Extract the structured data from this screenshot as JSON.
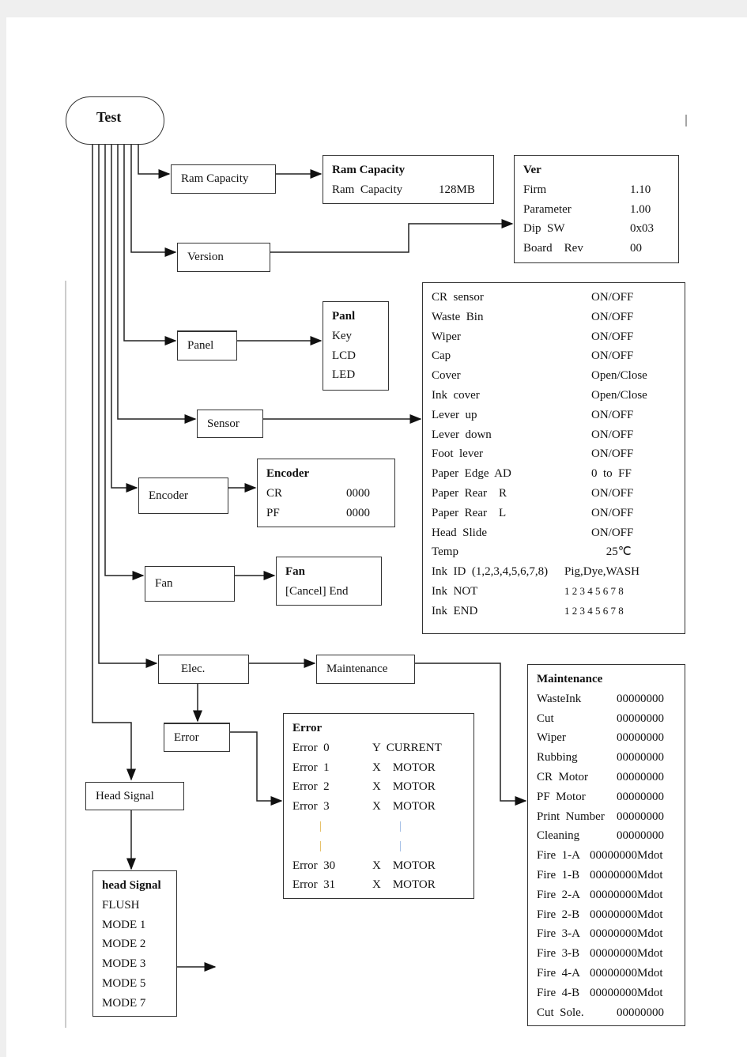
{
  "root": {
    "label": "Test"
  },
  "ram": {
    "button": "Ram  Capacity",
    "title": "Ram  Capacity",
    "rows": [
      [
        "Ram  Capacity",
        "128MB"
      ]
    ]
  },
  "version": {
    "button": "Version",
    "title": "Ver",
    "rows": [
      [
        "Firm",
        "1.10"
      ],
      [
        "Parameter",
        "1.00"
      ],
      [
        "Dip  SW",
        "0x03"
      ],
      [
        "Board    Rev",
        "00"
      ]
    ]
  },
  "panel": {
    "button": "Panel",
    "title": "Panl",
    "items": [
      "Key",
      "LCD",
      "LED"
    ]
  },
  "sensor": {
    "button": "Sensor",
    "rows": [
      [
        "CR  sensor",
        "ON/OFF"
      ],
      [
        "Waste  Bin",
        "ON/OFF"
      ],
      [
        "Wiper",
        "ON/OFF"
      ],
      [
        "Cap",
        "ON/OFF"
      ],
      [
        "Cover",
        "Open/Close"
      ],
      [
        "Ink  cover",
        "Open/Close"
      ],
      [
        "Lever  up",
        "ON/OFF"
      ],
      [
        "Lever  down",
        "ON/OFF"
      ],
      [
        "Foot  lever",
        "ON/OFF"
      ],
      [
        "Paper  Edge  AD",
        "0  to  FF"
      ],
      [
        "Paper  Rear    R",
        "ON/OFF"
      ],
      [
        "Paper  Rear    L",
        "ON/OFF"
      ],
      [
        "Head  Slide",
        "ON/OFF"
      ],
      [
        "Temp",
        "     25℃"
      ],
      [
        "Ink  ID  (1,2,3,4,5,6,7,8)",
        "Pig,Dye,WASH"
      ],
      [
        "Ink  NOT",
        "1 2 3 4 5 6 7 8"
      ],
      [
        "Ink  END",
        "1 2 3 4 5 6 7 8"
      ]
    ]
  },
  "encoder": {
    "button": "Encoder",
    "title": "Encoder",
    "rows": [
      [
        "CR",
        "0000"
      ],
      [
        "PF",
        "0000"
      ]
    ]
  },
  "fan": {
    "button": "Fan",
    "title": "Fan",
    "items": [
      "[Cancel]  End"
    ]
  },
  "elec": {
    "button": "Elec."
  },
  "maintenance": {
    "button": "Maintenance",
    "title": "Maintenance",
    "rows": [
      [
        "WasteInk",
        "00000000"
      ],
      [
        "Cut",
        "00000000"
      ],
      [
        "Wiper",
        "00000000"
      ],
      [
        "Rubbing",
        "00000000"
      ],
      [
        "CR  Motor",
        "00000000"
      ],
      [
        "PF  Motor",
        "00000000"
      ],
      [
        "Print  Number",
        "00000000"
      ],
      [
        "Cleaning",
        "00000000"
      ],
      [
        "Fire  1-A",
        "00000000Mdot"
      ],
      [
        "Fire  1-B",
        "00000000Mdot"
      ],
      [
        "Fire  2-A",
        "00000000Mdot"
      ],
      [
        "Fire  2-B",
        "00000000Mdot"
      ],
      [
        "Fire  3-A",
        "00000000Mdot"
      ],
      [
        "Fire  3-B",
        "00000000Mdot"
      ],
      [
        "Fire  4-A",
        "00000000Mdot"
      ],
      [
        "Fire  4-B",
        "00000000Mdot"
      ],
      [
        "Cut  Sole.",
        "00000000"
      ]
    ]
  },
  "error": {
    "button": "Error",
    "title": "Error",
    "rows_top": [
      [
        "Error  0",
        "Y  CURRENT"
      ],
      [
        "Error  1",
        "X    MOTOR"
      ],
      [
        "Error  2",
        "X    MOTOR"
      ],
      [
        "Error  3",
        "X    MOTOR"
      ]
    ],
    "ellipsis": "|",
    "rows_bottom": [
      [
        "Error  30",
        "X    MOTOR"
      ],
      [
        "Error  31",
        "X    MOTOR"
      ]
    ]
  },
  "head_signal": {
    "button": "Head  Signal",
    "title": "head  Signal",
    "items": [
      "FLUSH",
      "MODE  1",
      "MODE  2",
      "MODE  3",
      "MODE  5",
      "MODE  7"
    ]
  }
}
